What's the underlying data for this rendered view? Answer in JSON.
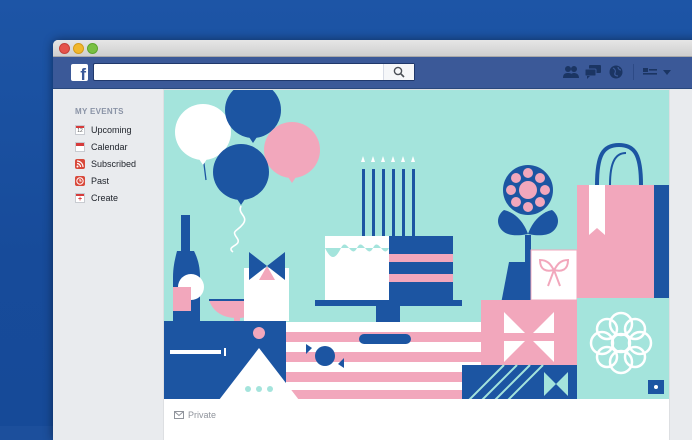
{
  "search": {
    "placeholder": ""
  },
  "sidebar": {
    "heading": "MY EVENTS",
    "items": [
      {
        "label": "Upcoming",
        "icon": "calendar-day-icon"
      },
      {
        "label": "Calendar",
        "icon": "calendar-icon"
      },
      {
        "label": "Subscribed",
        "icon": "rss-icon"
      },
      {
        "label": "Past",
        "icon": "clock-icon"
      },
      {
        "label": "Create",
        "icon": "plus-calendar-icon"
      }
    ],
    "upcoming_day": "12"
  },
  "event": {
    "privacy_label": "Private"
  },
  "colors": {
    "facebook_blue": "#3b5998",
    "cover_mint": "#a4e4dc",
    "navy": "#1c55a2",
    "pink": "#f2a7bc"
  }
}
